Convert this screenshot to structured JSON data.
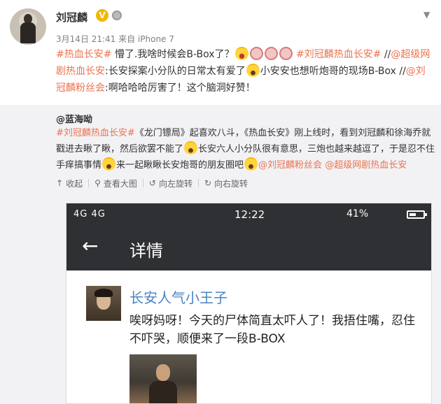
{
  "post": {
    "username": "刘冠麟",
    "verified_badge": "V",
    "meta": "3月14日 21:41 来自 iPhone 7",
    "text": {
      "tag1": "#热血长安#",
      "seg1": " 懵了.我啥时候会B-Box了？",
      "tag2": "#刘冠麟热血长安#",
      "seg2": " //",
      "mention1": "@超级网剧热血长安",
      "seg3": ":长安探案小分队的日常太有爱了",
      "seg4": "小安安也想听炮哥的现场B-Box //",
      "mention2": "@刘冠麟粉丝会",
      "seg5": ":啊哈哈哈厉害了！这个脑洞好赞！"
    }
  },
  "repost": {
    "username": "@蓝海呦",
    "text": {
      "tag1": "#刘冠麟热血长安#",
      "seg1": "《龙门镖局》起喜欢八斗，《热血长安》刚上线时，看到刘冠麟和徐海乔就戳进去瞅了瞅，然后欲罢不能了",
      "seg2": "长安六人小分队很有意思，三炮也越来越逗了，于是忍不住手痒搞事情",
      "seg3": "来一起瞅瞅长安炮哥的朋友圈吧",
      "mention1": "@刘冠麟粉丝会",
      "mention2": "@超级网剧热血长安"
    },
    "actions": {
      "collapse": "收起",
      "view_large": "查看大图",
      "rotate_left": "向左旋转",
      "rotate_right": "向右旋转"
    }
  },
  "phone": {
    "signal": "4G 4G",
    "time": "12:22",
    "status_right": "41%",
    "nav_title": "详情",
    "card_name": "长安人气小王子",
    "card_text": "唉呀妈呀！今天的尸体简直太吓人了！我捂住嘴，忍住不吓哭，顺便来了一段B-BOX"
  },
  "colors": {
    "link": "#eb7350",
    "repost_bg": "#f2f2f5",
    "phone_bar": "#2f3033",
    "card_name": "#4a83c4"
  },
  "icons": [
    "chevron-down-icon",
    "verified-icon",
    "mask-icon",
    "emoji-icon",
    "collapse-icon",
    "search-icon",
    "rotate-left-icon",
    "rotate-right-icon",
    "back-arrow-icon",
    "battery-icon"
  ]
}
